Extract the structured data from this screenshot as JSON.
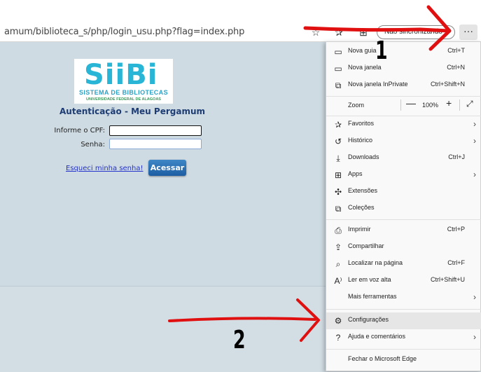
{
  "browser": {
    "url": "amum/biblioteca_s/php/login_usu.php?flag=index.php",
    "profile_label": "Não sincronizando",
    "more_label": "···",
    "icons": [
      "star-outline-icon",
      "favorites-list-icon",
      "collections-icon",
      "more-icon"
    ]
  },
  "page": {
    "logo_text": "SiiBi",
    "logo_subtitle": "SISTEMA DE BIBLIOTECAS",
    "logo_subtitle2": "UNIVERSIDADE FEDERAL DE ALAGOAS",
    "title": "Autenticação - Meu Pergamum",
    "cpf_label": "Informe o CPF:",
    "cpf_value": "",
    "password_label": "Senha:",
    "password_value": "",
    "forgot_link": "Esqueci minha senha!",
    "submit_label": "Acessar"
  },
  "menu": {
    "new_tab": {
      "label": "Nova guia",
      "shortcut": "Ctrl+T"
    },
    "new_window": {
      "label": "Nova janela",
      "shortcut": "Ctrl+N"
    },
    "new_inprivate": {
      "label": "Nova janela InPrivate",
      "shortcut": "Ctrl+Shift+N"
    },
    "zoom": {
      "label": "Zoom",
      "value": "100%",
      "minus": "—",
      "plus": "+"
    },
    "favorites": {
      "label": "Favoritos"
    },
    "history": {
      "label": "Histórico"
    },
    "downloads": {
      "label": "Downloads",
      "shortcut": "Ctrl+J"
    },
    "apps": {
      "label": "Apps"
    },
    "extensions": {
      "label": "Extensões"
    },
    "collections": {
      "label": "Coleções"
    },
    "print": {
      "label": "Imprimir",
      "shortcut": "Ctrl+P"
    },
    "share": {
      "label": "Compartilhar"
    },
    "find": {
      "label": "Localizar na página",
      "shortcut": "Ctrl+F"
    },
    "read_aloud": {
      "label": "Ler em voz alta",
      "shortcut": "Ctrl+Shift+U"
    },
    "more_tools": {
      "label": "Mais ferramentas"
    },
    "settings": {
      "label": "Configurações"
    },
    "help": {
      "label": "Ajuda e comentários"
    },
    "close": {
      "label": "Fechar o Microsoft Edge"
    }
  },
  "annotations": {
    "step1": "1",
    "step2": "2",
    "arrow_color": "#e01010"
  }
}
